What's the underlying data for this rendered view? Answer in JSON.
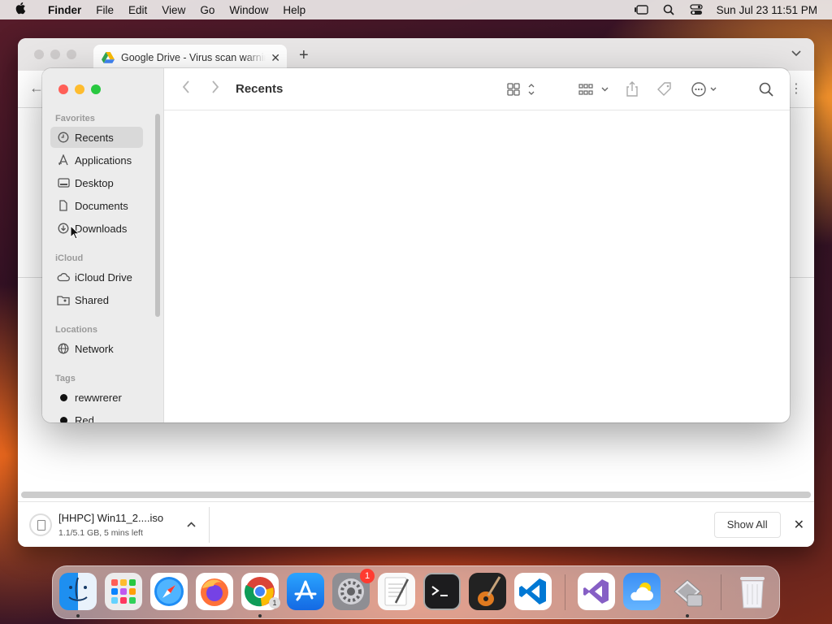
{
  "menubar": {
    "app_name": "Finder",
    "menus": [
      "File",
      "Edit",
      "View",
      "Go",
      "Window",
      "Help"
    ],
    "clock": "Sun Jul 23  11:51 PM"
  },
  "browser": {
    "tab_title": "Google Drive - Virus scan warning",
    "download": {
      "name": "[HHPC] Win11_2....iso",
      "status": "1.1/5.1 GB, 5 mins left",
      "progress": 0.22
    },
    "show_all": "Show All"
  },
  "finder": {
    "title": "Recents",
    "sidebar": {
      "favorites_header": "Favorites",
      "favorites": [
        {
          "label": "Recents",
          "icon": "clock-icon",
          "selected": true
        },
        {
          "label": "Applications",
          "icon": "applications-icon"
        },
        {
          "label": "Desktop",
          "icon": "desktop-icon"
        },
        {
          "label": "Documents",
          "icon": "document-icon"
        },
        {
          "label": "Downloads",
          "icon": "download-icon"
        }
      ],
      "icloud_header": "iCloud",
      "icloud": [
        {
          "label": "iCloud Drive",
          "icon": "cloud-icon"
        },
        {
          "label": "Shared",
          "icon": "shared-folder-icon"
        }
      ],
      "locations_header": "Locations",
      "locations": [
        {
          "label": "Network",
          "icon": "globe-icon"
        }
      ],
      "tags_header": "Tags",
      "tags": [
        {
          "label": "rewwrerer",
          "color": "#111111"
        },
        {
          "label": "Red",
          "color": "#111111"
        }
      ]
    }
  },
  "dock": {
    "apps": [
      "finder-icon",
      "launchpad-icon",
      "safari-icon",
      "firefox-icon",
      "chrome-icon",
      "app-store-icon",
      "system-settings-icon",
      "textedit-icon",
      "terminal-icon",
      "garageband-icon",
      "vscode-icon",
      "visual-studio-icon",
      "weather-icon",
      "migration-assistant-icon",
      "trash-icon"
    ],
    "settings_badge": "1",
    "chrome_badge": "1"
  }
}
